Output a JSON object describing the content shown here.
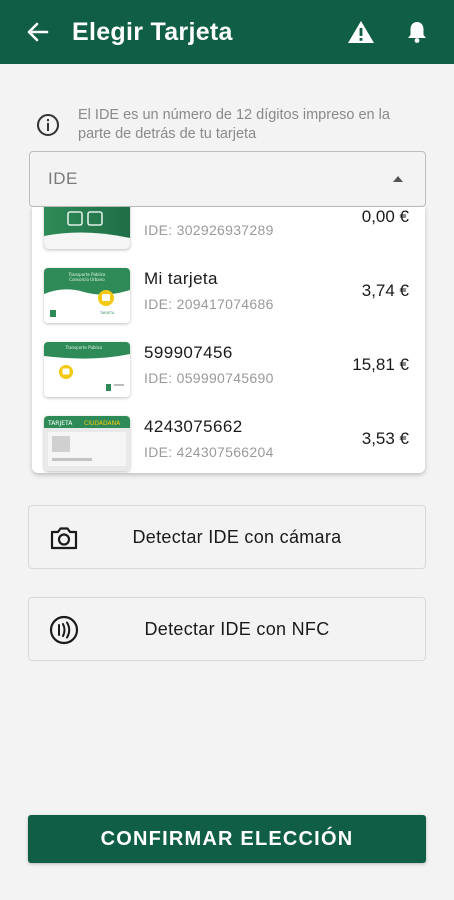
{
  "appbar": {
    "title": "Elegir Tarjeta",
    "back_icon": "arrow-back-icon",
    "warning_icon": "warning-icon",
    "bell_icon": "bell-icon"
  },
  "info": {
    "icon": "info-icon",
    "text": "El IDE es un número de 12 dígitos impreso en la parte de detrás de tu tarjeta"
  },
  "select": {
    "value": "IDE"
  },
  "cards": [
    {
      "name": "",
      "ide": "IDE: 302926937289",
      "amount": "0,00 €"
    },
    {
      "name": "Mi tarjeta",
      "ide": "IDE: 209417074686",
      "amount": "3,74 €"
    },
    {
      "name": "599907456",
      "ide": "IDE: 059990745690",
      "amount": "15,81 €"
    },
    {
      "name": "4243075662",
      "ide": "IDE: 424307566204",
      "amount": "3,53 €"
    }
  ],
  "actions": {
    "camera_label": "Detectar IDE con cámara",
    "nfc_label": "Detectar IDE con NFC"
  },
  "confirm_label": "CONFIRMAR ELECCIÓN",
  "colors": {
    "primary": "#0f5e45",
    "card_accent": "#2e8b57"
  }
}
